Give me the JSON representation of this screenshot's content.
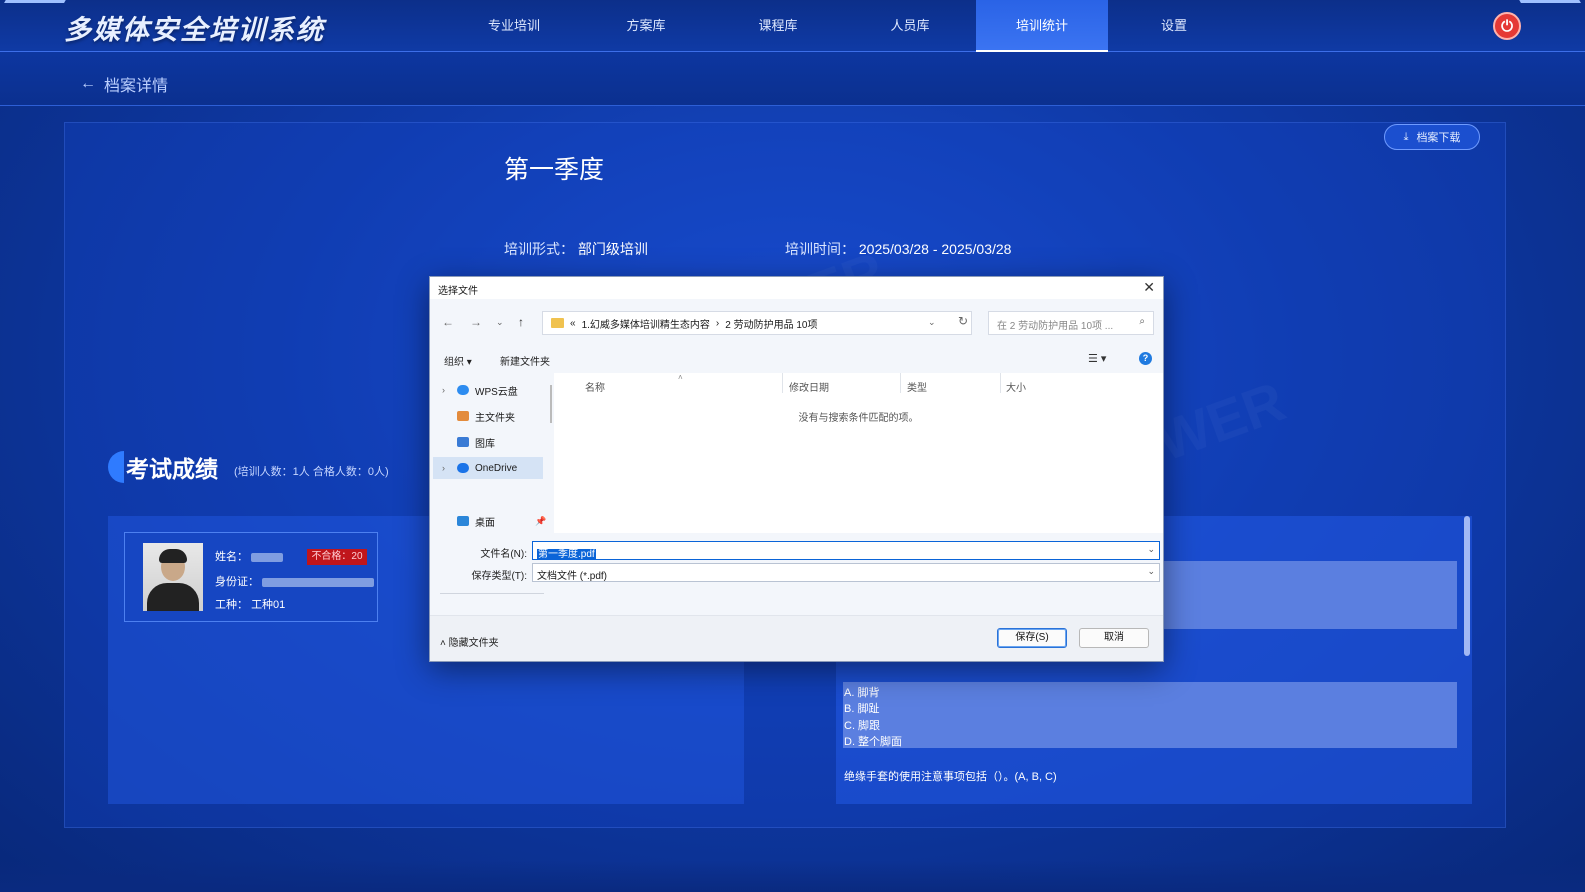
{
  "app": {
    "title": "多媒体安全培训系统"
  },
  "nav": {
    "items": [
      "专业培训",
      "方案库",
      "课程库",
      "人员库",
      "培训统计",
      "设置"
    ],
    "active": "培训统计"
  },
  "subheader": {
    "back_label": "档案详情"
  },
  "detail": {
    "download_label": "档案下载",
    "season_title": "第一季度",
    "form_label": "培训形式：",
    "form_value": "部门级培训",
    "time_label": "培训时间：",
    "time_value": "2025/03/28 - 2025/03/28"
  },
  "exam": {
    "title": "考试成绩",
    "summary": "(培训人数：1人  合格人数：0人)",
    "person": {
      "name_label": "姓名：",
      "id_label": "身份证：",
      "job_label": "工种：",
      "job_value": "工种01",
      "badge": "不合格：20"
    },
    "options": [
      "A. 脚背",
      "B. 脚趾",
      "C. 脚跟",
      "D. 整个脚面"
    ],
    "question": "绝缘手套的使用注意事项包括（）。(A, B, C)"
  },
  "dialog": {
    "title": "选择文件",
    "breadcrumb_prefix": "«",
    "breadcrumb_1": "1.幻威多媒体培训精生态内容",
    "breadcrumb_sep": "›",
    "breadcrumb_2": "2  劳动防护用品 10项",
    "search_placeholder": "在 2  劳动防护用品 10项 ...",
    "organize_label": "组织 ▾",
    "new_folder_label": "新建文件夹",
    "tree": {
      "wps": "WPS云盘",
      "home": "主文件夹",
      "gallery": "图库",
      "onedrive": "OneDrive",
      "desktop": "桌面"
    },
    "columns": {
      "name": "名称",
      "modified": "修改日期",
      "type": "类型",
      "size": "大小"
    },
    "empty_message": "没有与搜索条件匹配的项。",
    "filename_label": "文件名(N):",
    "filename_value": "第一季度.pdf",
    "filetype_label": "保存类型(T):",
    "filetype_value": "文档文件 (*.pdf)",
    "hide_folders_label": "隐藏文件夹",
    "save_label": "保存(S)",
    "cancel_label": "取消"
  },
  "colors": {
    "accent": "#2f7bff",
    "fail": "#c0151b",
    "power": "#e53935",
    "selection": "#0a64d8"
  },
  "icons": {
    "power": "power-icon",
    "back": "arrow-left-icon",
    "download": "download-icon",
    "help": "help-icon",
    "search": "search-icon"
  }
}
